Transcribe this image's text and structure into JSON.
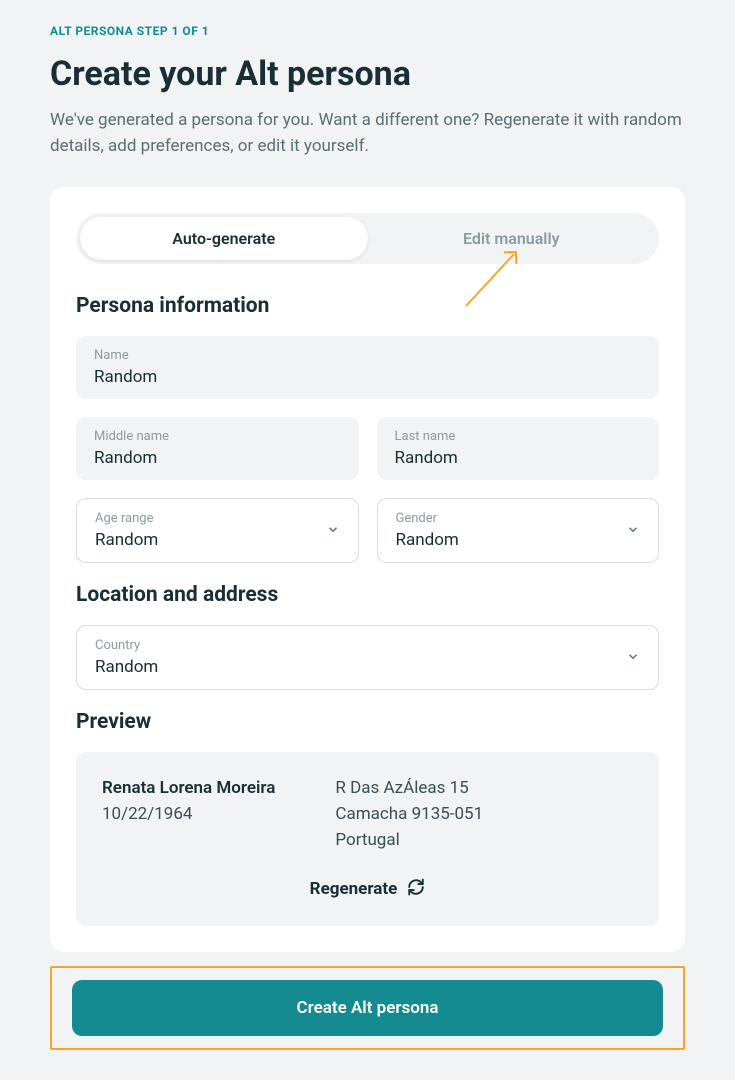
{
  "header": {
    "step_label": "ALT PERSONA STEP 1 OF 1",
    "title": "Create your Alt persona",
    "subtitle": "We've generated a persona for you. Want a different one? Regenerate it with random details, add preferences, or edit it yourself."
  },
  "tabs": {
    "auto": "Auto-generate",
    "manual": "Edit manually"
  },
  "sections": {
    "persona_info": "Persona information",
    "location": "Location and address",
    "preview": "Preview"
  },
  "fields": {
    "name": {
      "label": "Name",
      "value": "Random"
    },
    "middle_name": {
      "label": "Middle name",
      "value": "Random"
    },
    "last_name": {
      "label": "Last name",
      "value": "Random"
    },
    "age_range": {
      "label": "Age range",
      "value": "Random"
    },
    "gender": {
      "label": "Gender",
      "value": "Random"
    },
    "country": {
      "label": "Country",
      "value": "Random"
    }
  },
  "preview_data": {
    "name": "Renata Lorena Moreira",
    "dob": "10/22/1964",
    "address_line1": "R Das AzÁleas 15",
    "address_line2": "Camacha 9135-051",
    "address_country": "Portugal"
  },
  "actions": {
    "regenerate": "Regenerate",
    "create": "Create Alt persona"
  }
}
